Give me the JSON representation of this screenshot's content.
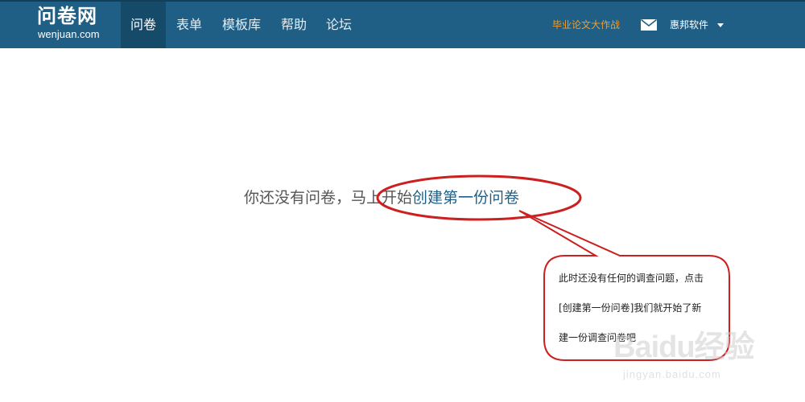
{
  "header": {
    "logo_cn": "问卷网",
    "logo_en": "wenjuan.com",
    "nav": [
      {
        "label": "问卷",
        "active": true
      },
      {
        "label": "表单",
        "active": false
      },
      {
        "label": "模板库",
        "active": false
      },
      {
        "label": "帮助",
        "active": false
      },
      {
        "label": "论坛",
        "active": false
      }
    ],
    "promo_link": "毕业论文大作战",
    "mail_icon": "envelope-icon",
    "user_name": "惠邦软件",
    "user_caret_icon": "caret-down-icon",
    "colors": {
      "nav_bg": "#1f5f86",
      "nav_active_bg": "#164a69",
      "promo": "#f39c28"
    }
  },
  "main": {
    "empty_text": "你还没有问卷，马上开始",
    "create_link": "创建第一份问卷"
  },
  "annotation": {
    "lines": [
      "此时还没有任何的调查问题，点击",
      "[创建第一份问卷]我们就开始了新",
      "建一份调查问卷吧"
    ],
    "color": "#cc1f1f"
  },
  "watermark": {
    "logo": "Baidu经验",
    "url": "jingyan.baidu.com"
  }
}
